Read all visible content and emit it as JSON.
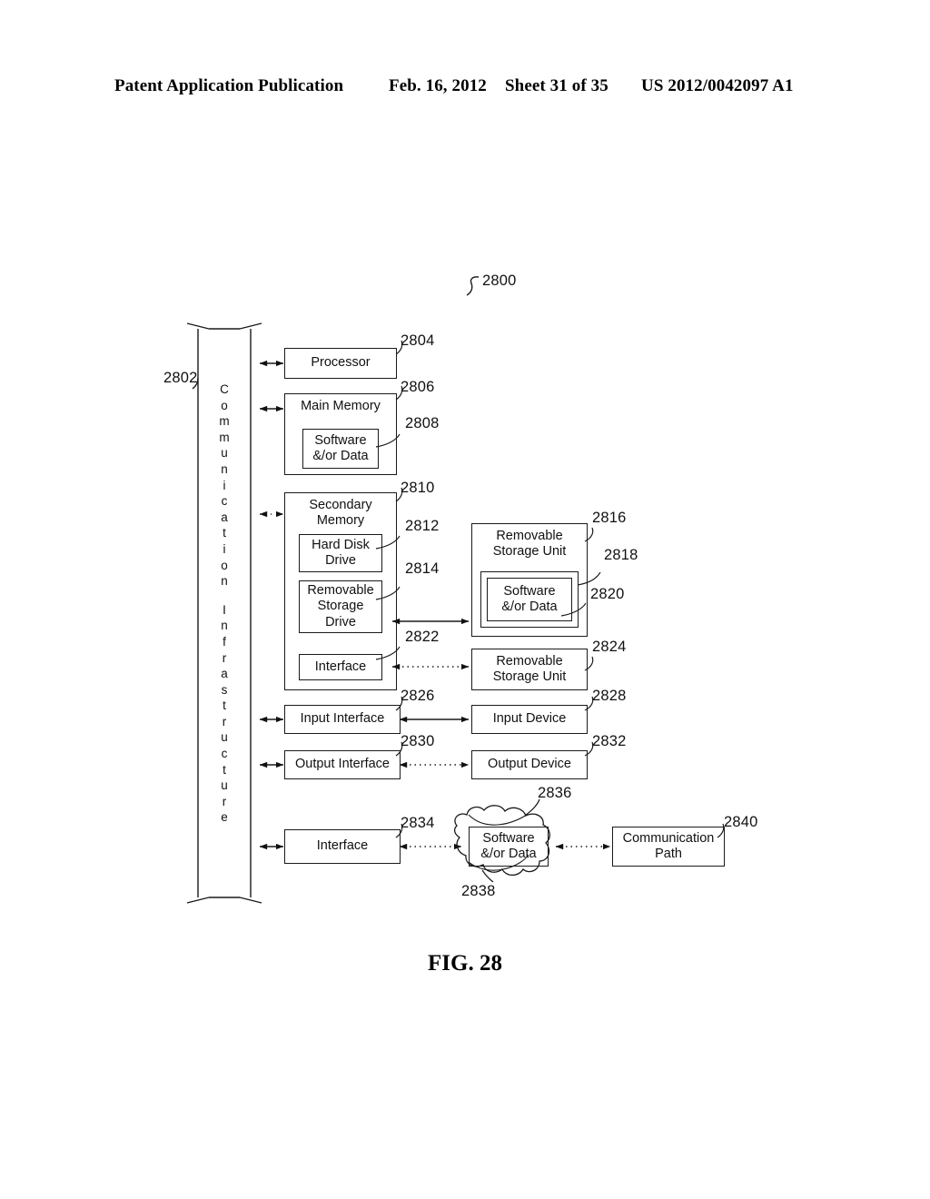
{
  "header": {
    "publication": "Patent Application Publication",
    "date": "Feb. 16, 2012",
    "sheet": "Sheet 31 of 35",
    "number": "US 2012/0042097 A1"
  },
  "figure": {
    "caption": "FIG. 28",
    "system_ref": "2800"
  },
  "bus": {
    "ref": "2802",
    "label": "Communication Infrastructure",
    "letters": [
      "C",
      "o",
      "m",
      "m",
      "u",
      "n",
      "i",
      "c",
      "a",
      "t",
      "i",
      "o",
      "n",
      "",
      "I",
      "n",
      "f",
      "r",
      "a",
      "s",
      "t",
      "r",
      "u",
      "c",
      "t",
      "u",
      "r",
      "e"
    ]
  },
  "blocks": {
    "processor": {
      "ref": "2804",
      "label": "Processor"
    },
    "main_memory": {
      "ref": "2806",
      "label": "Main Memory"
    },
    "main_memory_software": {
      "ref": "2808",
      "label_line1": "Software",
      "label_line2": "&/or Data"
    },
    "secondary_memory": {
      "ref": "2810",
      "label_line1": "Secondary",
      "label_line2": "Memory"
    },
    "hard_disk_drive": {
      "ref": "2812",
      "label_line1": "Hard Disk",
      "label_line2": "Drive"
    },
    "removable_storage_drive": {
      "ref": "2814",
      "label_line1": "Removable",
      "label_line2": "Storage",
      "label_line3": "Drive"
    },
    "removable_storage_unit_1": {
      "ref": "2816",
      "label_line1": "Removable",
      "label_line2": "Storage Unit"
    },
    "rsu_inner_frame": {
      "ref": "2818"
    },
    "rsu_software": {
      "ref": "2820",
      "label_line1": "Software",
      "label_line2": "&/or Data"
    },
    "interface_secondary": {
      "ref": "2822",
      "label": "Interface"
    },
    "removable_storage_unit_2": {
      "ref": "2824",
      "label_line1": "Removable",
      "label_line2": "Storage Unit"
    },
    "input_interface": {
      "ref": "2826",
      "label": "Input Interface"
    },
    "input_device": {
      "ref": "2828",
      "label": "Input Device"
    },
    "output_interface": {
      "ref": "2830",
      "label": "Output Interface"
    },
    "output_device": {
      "ref": "2832",
      "label": "Output Device"
    },
    "interface_comm": {
      "ref": "2834",
      "label": "Interface"
    },
    "signal_cloud": {
      "ref": "2836"
    },
    "cloud_software": {
      "ref": "2838",
      "label_line1": "Software",
      "label_line2": "&/or Data"
    },
    "communication_path": {
      "ref": "2840",
      "label_line1": "Communication",
      "label_line2": "Path"
    }
  }
}
